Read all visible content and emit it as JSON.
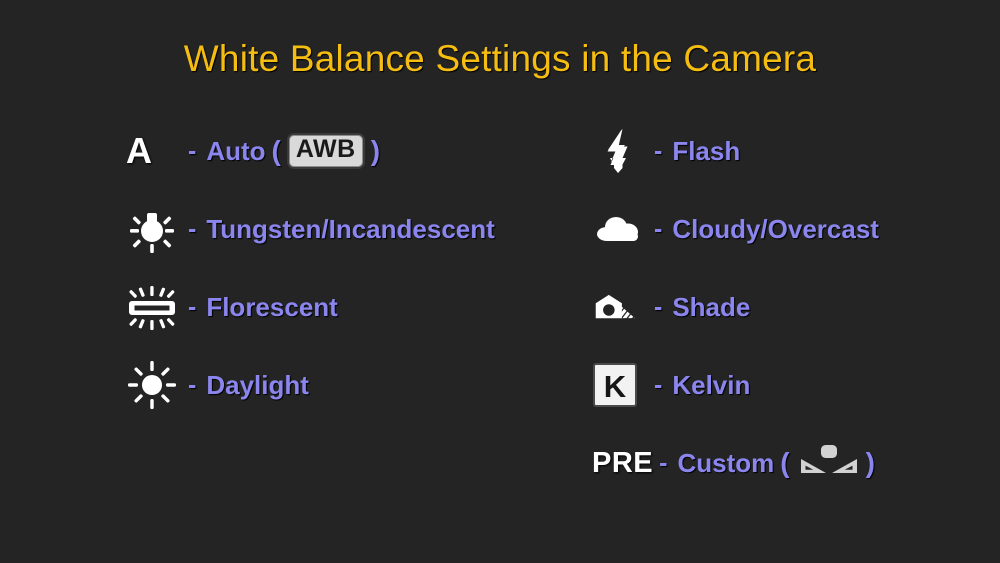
{
  "slide": {
    "title": "White Balance Settings in the Camera",
    "background_color": "#242424",
    "title_color": "#f5bc11",
    "label_color": "#8b85ee",
    "icon_color": "#ffffff",
    "dash": "-",
    "paren_open": "(",
    "paren_close": ")"
  },
  "left_column": [
    {
      "icon": "letter-a-icon",
      "icon_text": "A",
      "dash": "-",
      "label": "Auto",
      "badge": "AWB",
      "paren_open": "(",
      "paren_close": ")"
    },
    {
      "icon": "lightbulb-icon",
      "dash": "-",
      "label": "Tungsten/Incandescent"
    },
    {
      "icon": "fluorescent-tube-icon",
      "dash": "-",
      "label": "Florescent"
    },
    {
      "icon": "sun-icon",
      "dash": "-",
      "label": "Daylight"
    }
  ],
  "right_column": [
    {
      "icon": "lightning-bolt-icon",
      "dash": "-",
      "label": "Flash"
    },
    {
      "icon": "cloud-icon",
      "dash": "-",
      "label": "Cloudy/Overcast"
    },
    {
      "icon": "house-shade-icon",
      "dash": "-",
      "label": "Shade"
    },
    {
      "icon": "letter-k-box-icon",
      "icon_text": "K",
      "dash": "-",
      "label": "Kelvin"
    },
    {
      "icon": "pre-text-icon",
      "icon_text": "PRE",
      "dash": "-",
      "label": "Custom",
      "preset_icon": "preset-white-balance-icon",
      "paren_open": "(",
      "paren_close": ")"
    }
  ]
}
